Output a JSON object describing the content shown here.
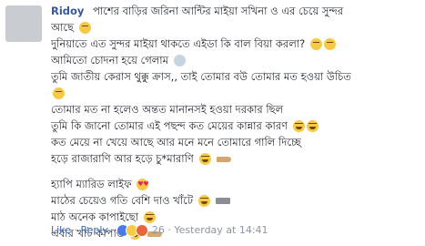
{
  "comment": {
    "author": "Ridoy",
    "lines": [
      "পাশের বাড়ির জরিনা আন্টির মাইয়া সখিনা ও এর চেয়ে সুন্দর",
      "আছে",
      "দুনিয়াতে এত সুন্দর মাইয়া থাকতে এইডা কি বাল বিয়া করলা?",
      "আমিতো চোদনা হয়ে গেলাম",
      "তুমি জাতীয় কেরাস থুক্কু ক্রাস,, তাই তোমার বউ তোমার মত হওয়া উচিত",
      "তোমার মত না হলেও অন্তত মানানসই হওয়া দরকার ছিল",
      "তুমি কি জানো তোমার এই পছন্দ কত মেয়ের কান্নার কারণ",
      "কত মেয়ে না খেয়ে আছে আর মনে মনে তোমারে গালি দিচ্ছে",
      "হড়ে রাজারাণি আর হড়ে চু*মারাণি",
      "হ্যাপি ম্যারিড লাইফ",
      "মাঠের চেয়েও গতি বেশি দাও খাঁটে",
      "মাঠ অনেক কাপাইছো",
      "এবার খাট কাপাও"
    ]
  },
  "icons": {
    "avatar": "avatar-icon",
    "tired": "tired-face-icon",
    "fear": "fearful-face-icon",
    "laugh": "tears-of-joy-icon",
    "heart_eyes": "heart-eyes-icon",
    "hand": "pointing-hand-icon",
    "gun": "pistol-icon"
  },
  "actions": {
    "like": "Like",
    "sep1": "·",
    "reply": "Reply",
    "sep2": "·",
    "reaction_count": "26",
    "sep3": "·",
    "timestamp": "Yesterday at 14:41"
  },
  "colors": {
    "link": "#4267b2",
    "author": "#365899",
    "text": "#1d2129",
    "meta": "#90949c"
  }
}
